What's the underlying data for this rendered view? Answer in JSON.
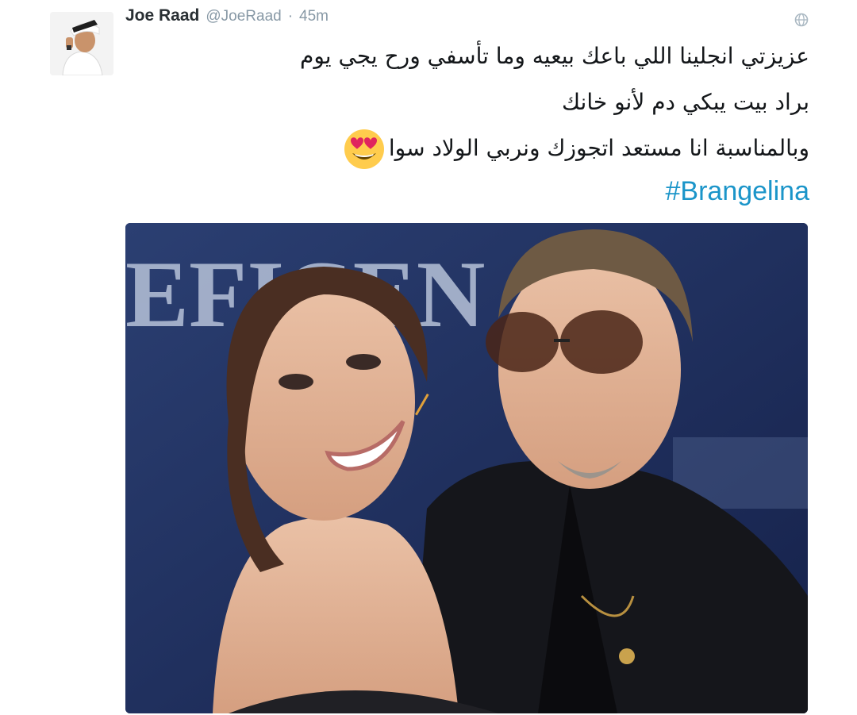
{
  "author": {
    "name": "Joe Raad",
    "handle": "@JoeRaad",
    "separator": "·",
    "time": "45m"
  },
  "tweet": {
    "line_1": "عزيزتي انجلينا اللي باعك بيعيه وما تأسفي ورح يجي يوم",
    "line_2": "براد بيت يبكي دم لأنو خانك",
    "line_3": "وبالمناسبة انا مستعد اتجوزك ونربي الولاد سوا",
    "hashtag": "#Brangelina"
  },
  "icons": {
    "globe": "globe-icon",
    "emoji": "smiling-face-with-heart-eyes-emoji"
  },
  "photo": {
    "backdrop_text": "EFICEN"
  },
  "colors": {
    "name": "#292f33",
    "meta": "#8899a6",
    "text": "#14171a",
    "hashtag": "#1b95c9",
    "photo_backdrop": "#1c2c55"
  }
}
